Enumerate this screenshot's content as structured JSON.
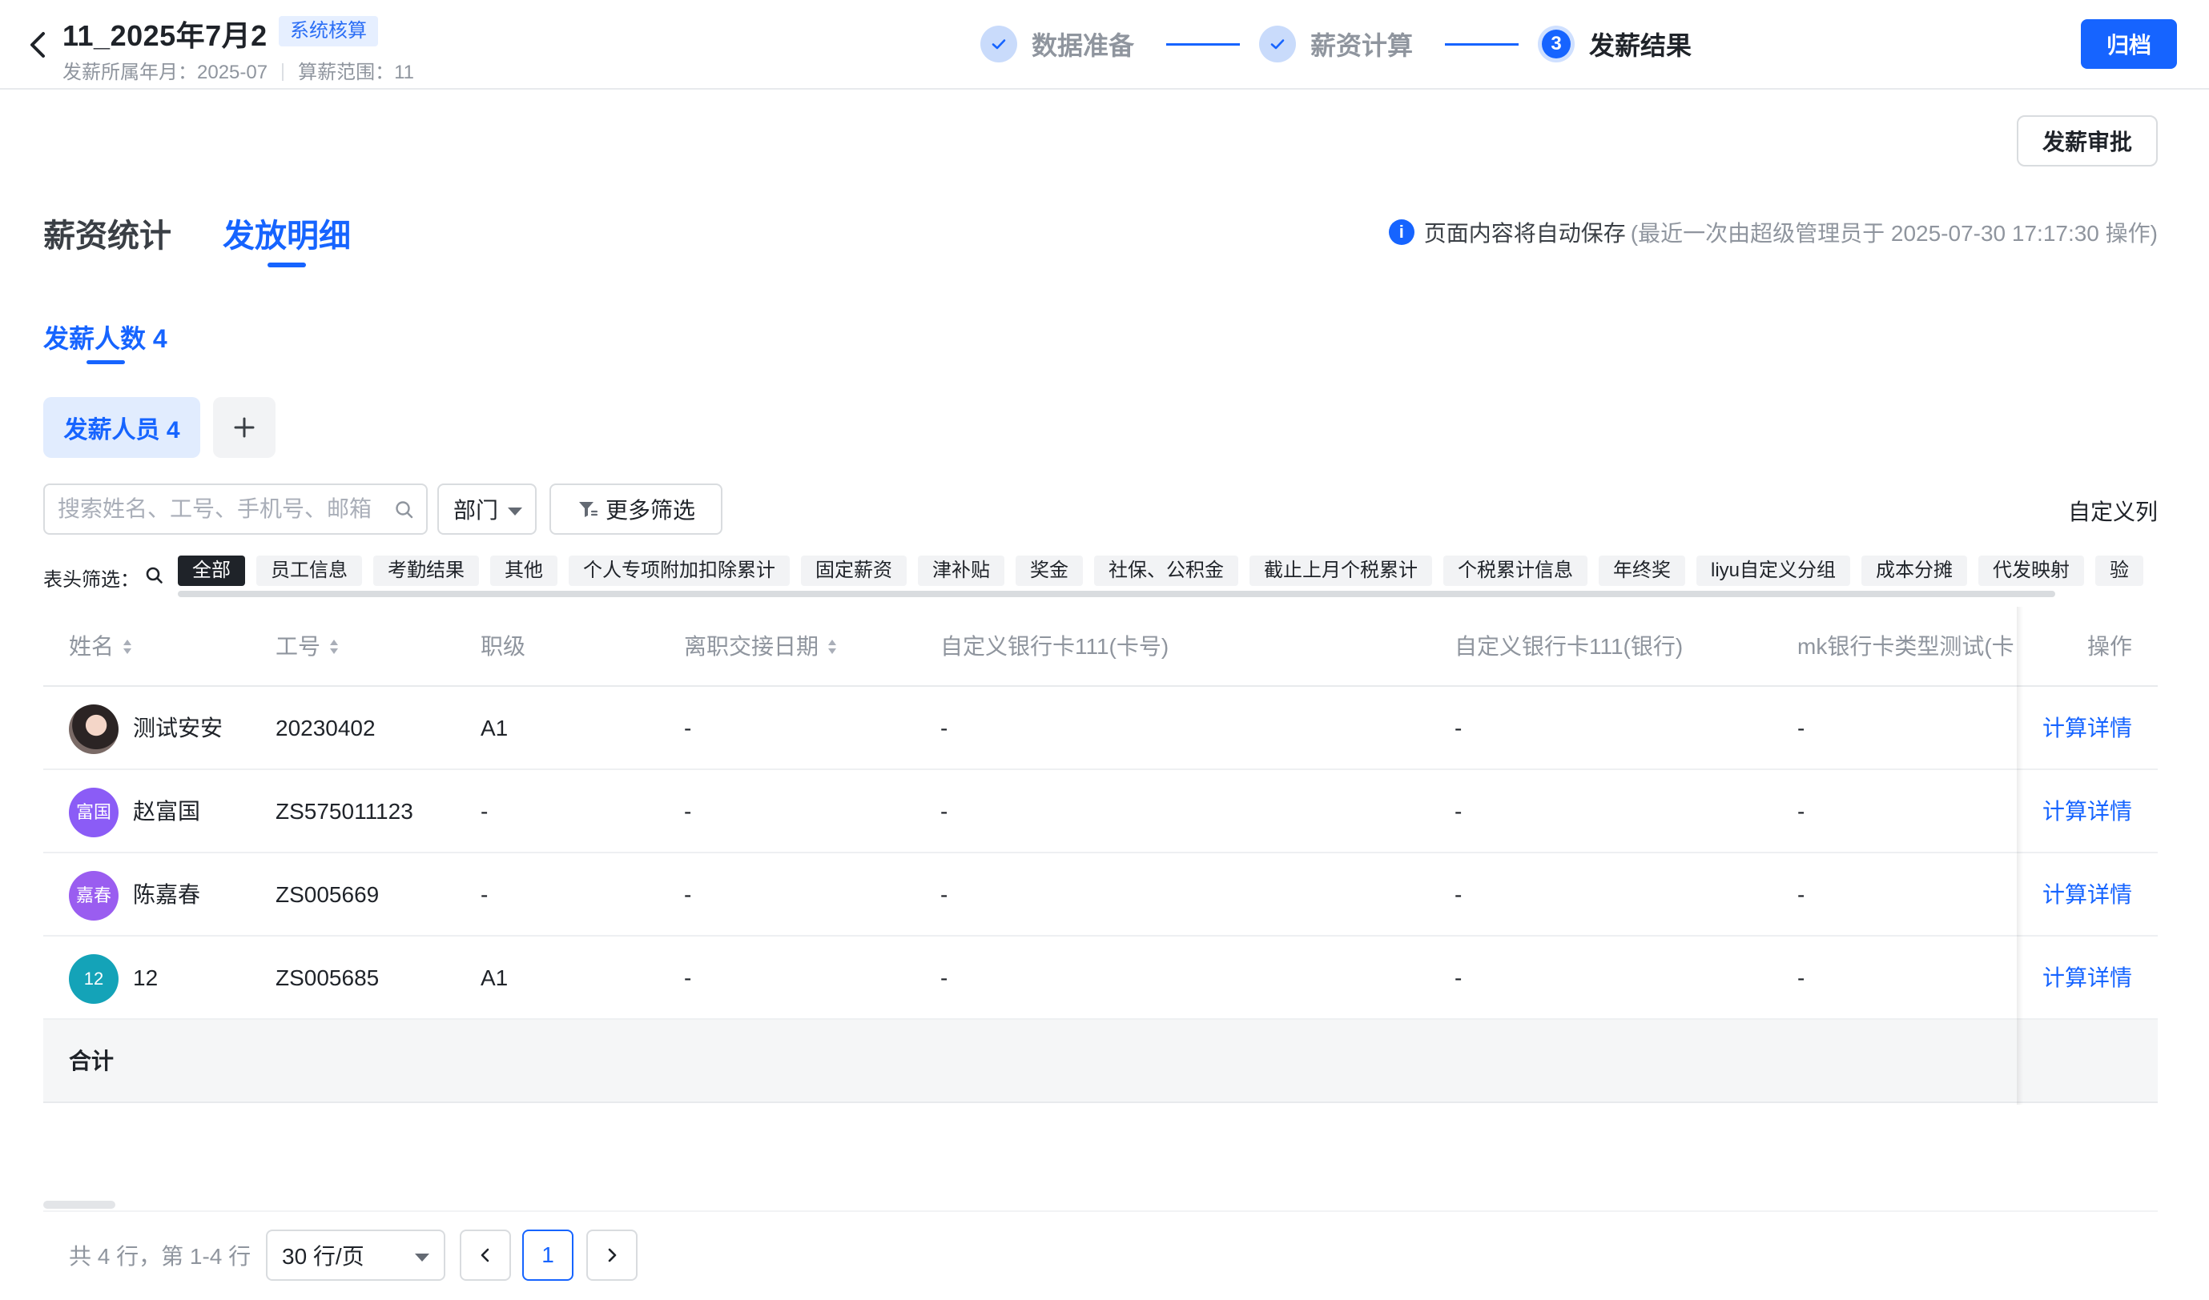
{
  "header": {
    "title": "11_2025年7月2",
    "badge": "系统核算",
    "meta_month": "发薪所属年月：2025-07",
    "meta_scope": "算薪范围：11",
    "archive_label": "归档"
  },
  "steps": [
    {
      "label": "数据准备",
      "status": "done"
    },
    {
      "label": "薪资计算",
      "status": "done"
    },
    {
      "label": "发薪结果",
      "status": "active",
      "number": "3"
    }
  ],
  "toolbar": {
    "approve_label": "发薪审批"
  },
  "main_tabs": [
    {
      "label": "薪资统计",
      "active": false
    },
    {
      "label": "发放明细",
      "active": true
    }
  ],
  "autosave": {
    "text": "页面内容将自动保存",
    "meta": "(最近一次由超级管理员于 2025-07-30 17:17:30 操作)"
  },
  "count_tab": "发薪人数 4",
  "group_chip": "发薪人员  4",
  "filters": {
    "search_placeholder": "搜索姓名、工号、手机号、邮箱",
    "department_label": "部门",
    "more_label": "更多筛选",
    "custom_columns_label": "自定义列",
    "header_filter_label": "表头筛选："
  },
  "header_chips": [
    "全部",
    "员工信息",
    "考勤结果",
    "其他",
    "个人专项附加扣除累计",
    "固定薪资",
    "津补贴",
    "奖金",
    "社保、公积金",
    "截止上月个税累计",
    "个税累计信息",
    "年终奖",
    "liyu自定义分组",
    "成本分摊",
    "代发映射",
    "验"
  ],
  "table": {
    "columns": [
      "姓名",
      "工号",
      "职级",
      "离职交接日期",
      "自定义银行卡111(卡号)",
      "自定义银行卡111(银行)",
      "mk银行卡类型测试(卡",
      "操作"
    ],
    "rows": [
      {
        "avatar": "",
        "name": "测试安安",
        "id": "20230402",
        "level": "A1",
        "leave_date": "-",
        "card_no": "-",
        "bank": "-",
        "mk": "-",
        "op": "计算详情"
      },
      {
        "avatar": "富国",
        "name": "赵富国",
        "id": "ZS575011123",
        "level": "-",
        "leave_date": "-",
        "card_no": "-",
        "bank": "-",
        "mk": "-",
        "op": "计算详情"
      },
      {
        "avatar": "嘉春",
        "name": "陈嘉春",
        "id": "ZS005669",
        "level": "-",
        "leave_date": "-",
        "card_no": "-",
        "bank": "-",
        "mk": "-",
        "op": "计算详情"
      },
      {
        "avatar": "12",
        "name": "12",
        "id": "ZS005685",
        "level": "A1",
        "leave_date": "-",
        "card_no": "-",
        "bank": "-",
        "mk": "-",
        "op": "计算详情"
      }
    ],
    "summary_label": "合计"
  },
  "pagination": {
    "total_text": "共 4 行，第 1-4 行",
    "page_size": "30 行/页",
    "prev": "‹",
    "current_page": "1",
    "next": "›"
  },
  "colors": {
    "primary": "#1664ff",
    "avatar_fuguo": "#8b5cf6",
    "avatar_jiachun": "#9a5df0",
    "avatar_12": "#14a3b8"
  }
}
